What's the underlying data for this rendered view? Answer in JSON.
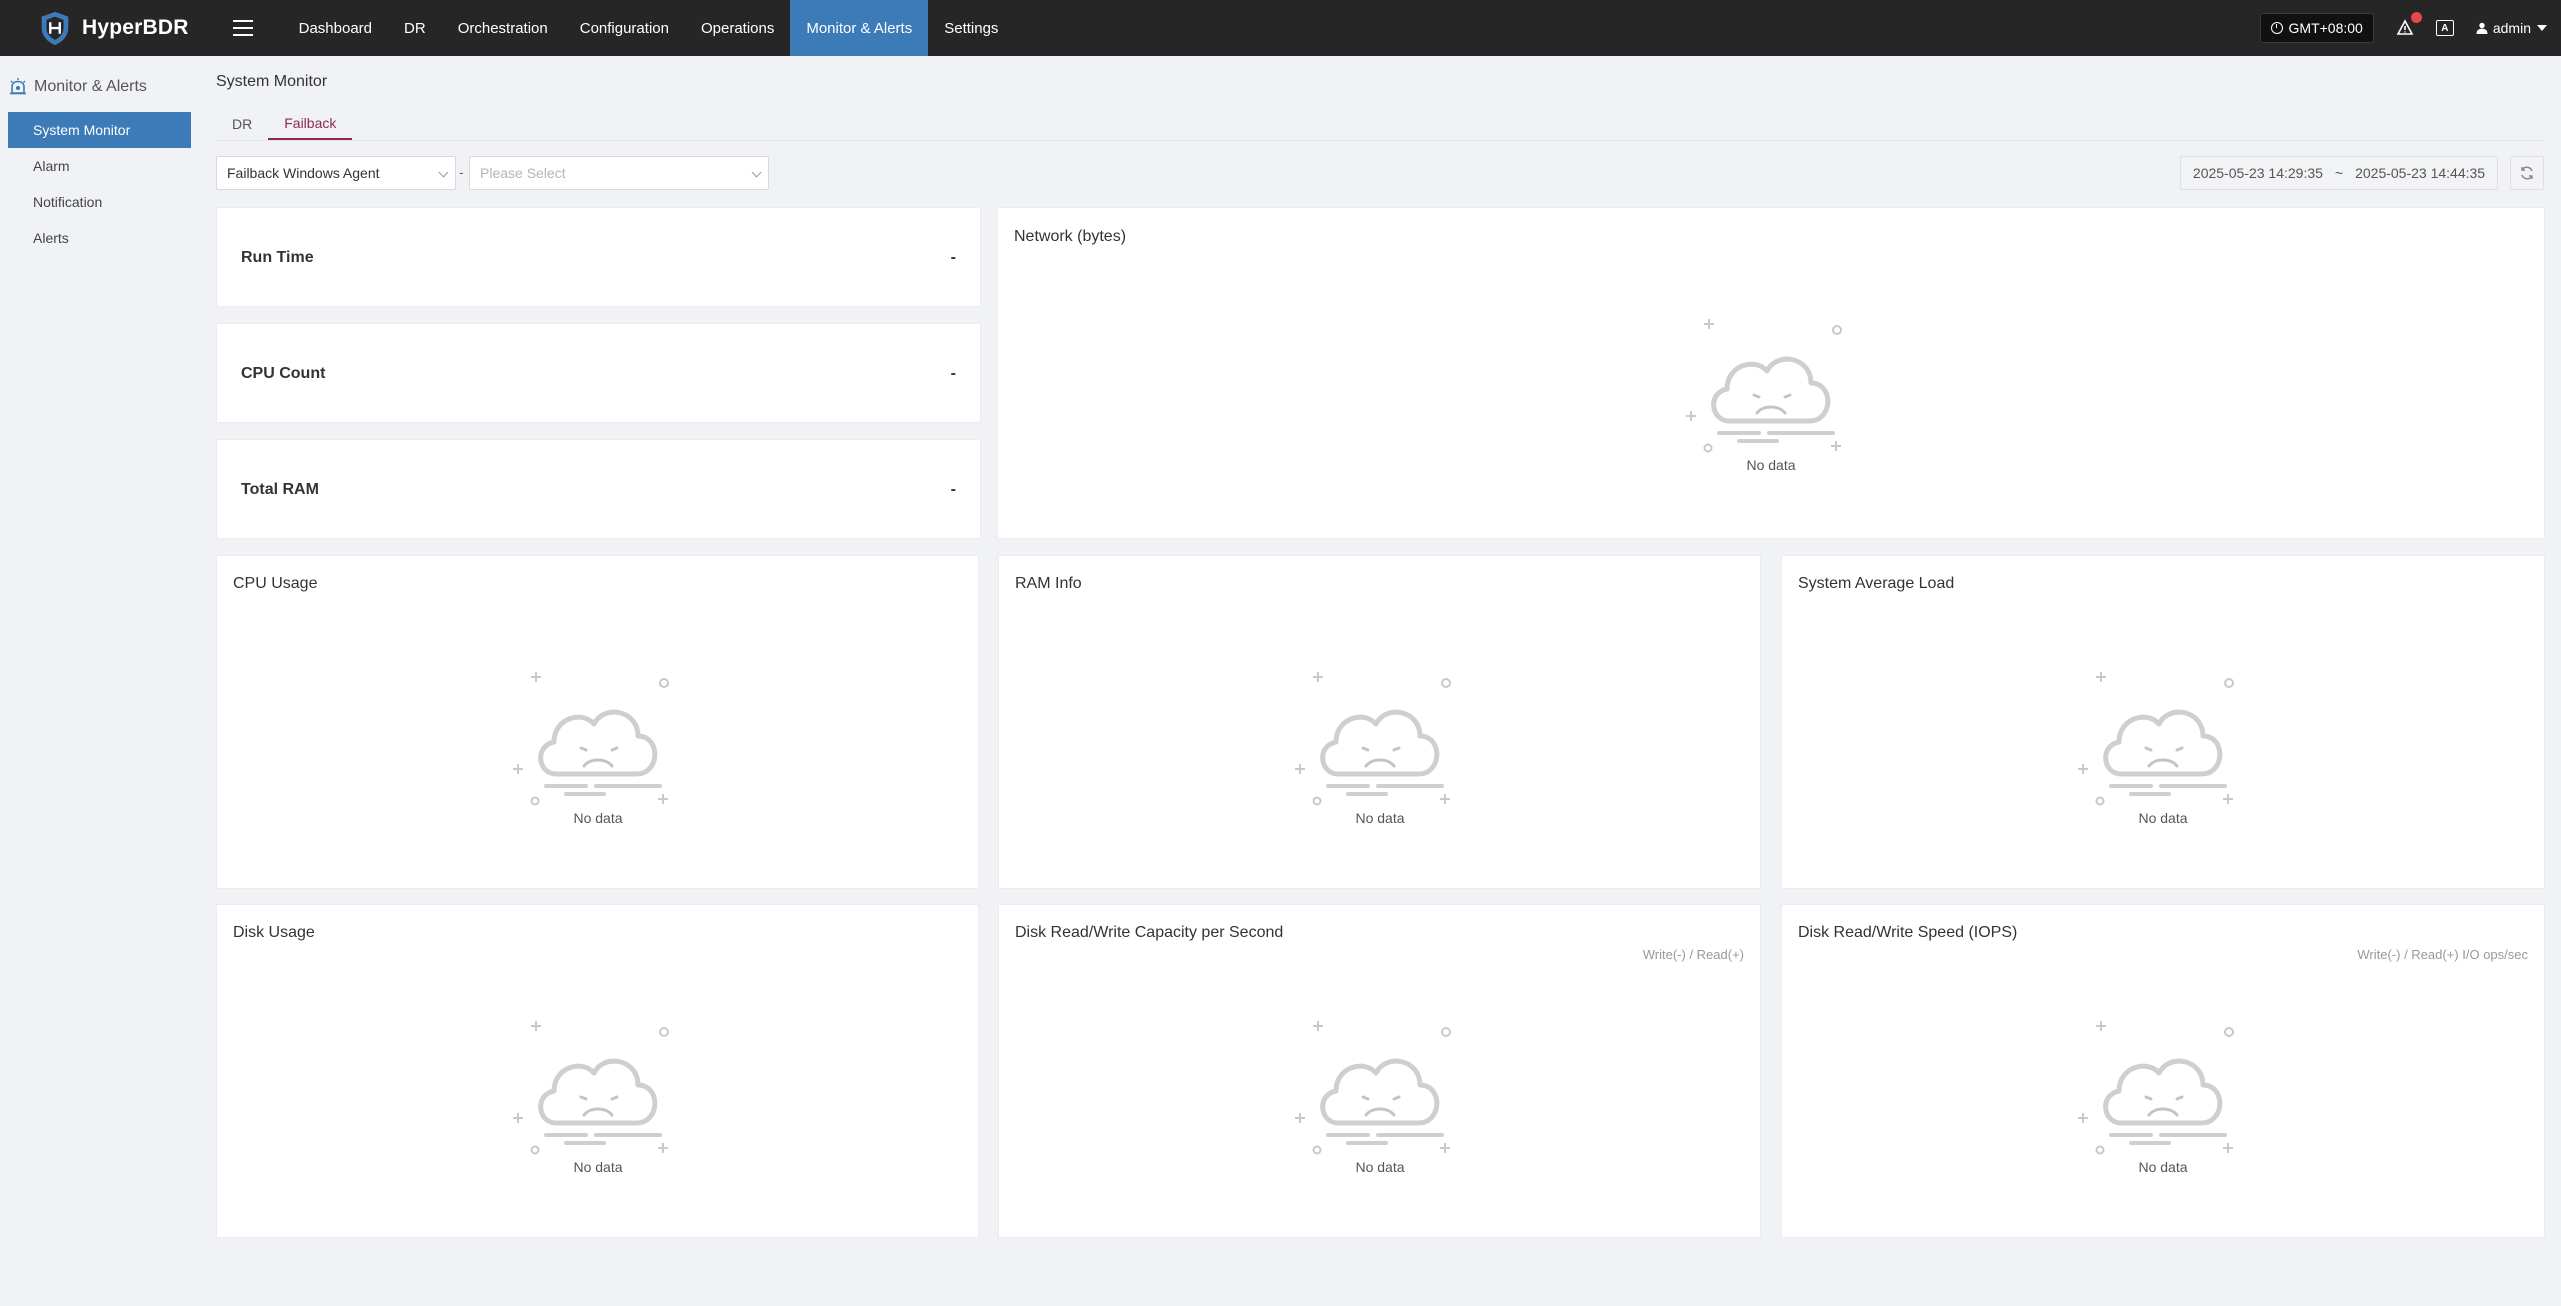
{
  "app": {
    "name": "HyperBDR"
  },
  "nav": {
    "items": [
      {
        "label": "Dashboard",
        "active": false
      },
      {
        "label": "DR",
        "active": false
      },
      {
        "label": "Orchestration",
        "active": false
      },
      {
        "label": "Configuration",
        "active": false
      },
      {
        "label": "Operations",
        "active": false
      },
      {
        "label": "Monitor & Alerts",
        "active": true
      },
      {
        "label": "Settings",
        "active": false
      }
    ]
  },
  "header": {
    "timezone": "GMT+08:00",
    "lang_icon": "A",
    "user": "admin"
  },
  "sidebar": {
    "section": "Monitor & Alerts",
    "items": [
      {
        "label": "System Monitor",
        "active": true
      },
      {
        "label": "Alarm",
        "active": false
      },
      {
        "label": "Notification",
        "active": false
      },
      {
        "label": "Alerts",
        "active": false
      }
    ]
  },
  "main": {
    "title": "System Monitor",
    "tabs": [
      {
        "label": "DR",
        "active": false
      },
      {
        "label": "Failback",
        "active": true
      }
    ],
    "filters": {
      "agent_type": "Failback Windows Agent",
      "separator": "-",
      "host_placeholder": "Please Select",
      "date_start": "2025-05-23 14:29:35",
      "date_sep": "~",
      "date_end": "2025-05-23 14:44:35"
    },
    "stats": [
      {
        "label": "Run Time",
        "value": "-"
      },
      {
        "label": "CPU Count",
        "value": "-"
      },
      {
        "label": "Total RAM",
        "value": "-"
      }
    ],
    "charts": {
      "network": {
        "title": "Network (bytes)",
        "empty": "No data"
      },
      "cpu": {
        "title": "CPU Usage",
        "empty": "No data"
      },
      "ram": {
        "title": "RAM Info",
        "empty": "No data"
      },
      "load": {
        "title": "System Average Load",
        "empty": "No data"
      },
      "disk": {
        "title": "Disk Usage",
        "empty": "No data"
      },
      "disk_capacity": {
        "title": "Disk Read/Write Capacity per Second",
        "unit": "Write(-) / Read(+)",
        "empty": "No data"
      },
      "disk_iops": {
        "title": "Disk Read/Write Speed (IOPS)",
        "unit": "Write(-) / Read(+) I/O ops/sec",
        "empty": "No data"
      }
    }
  },
  "colors": {
    "topbar": "#262626",
    "accent": "#3d7ab8",
    "tab_active": "#8b2a55",
    "page_bg": "#f0f2f5"
  }
}
